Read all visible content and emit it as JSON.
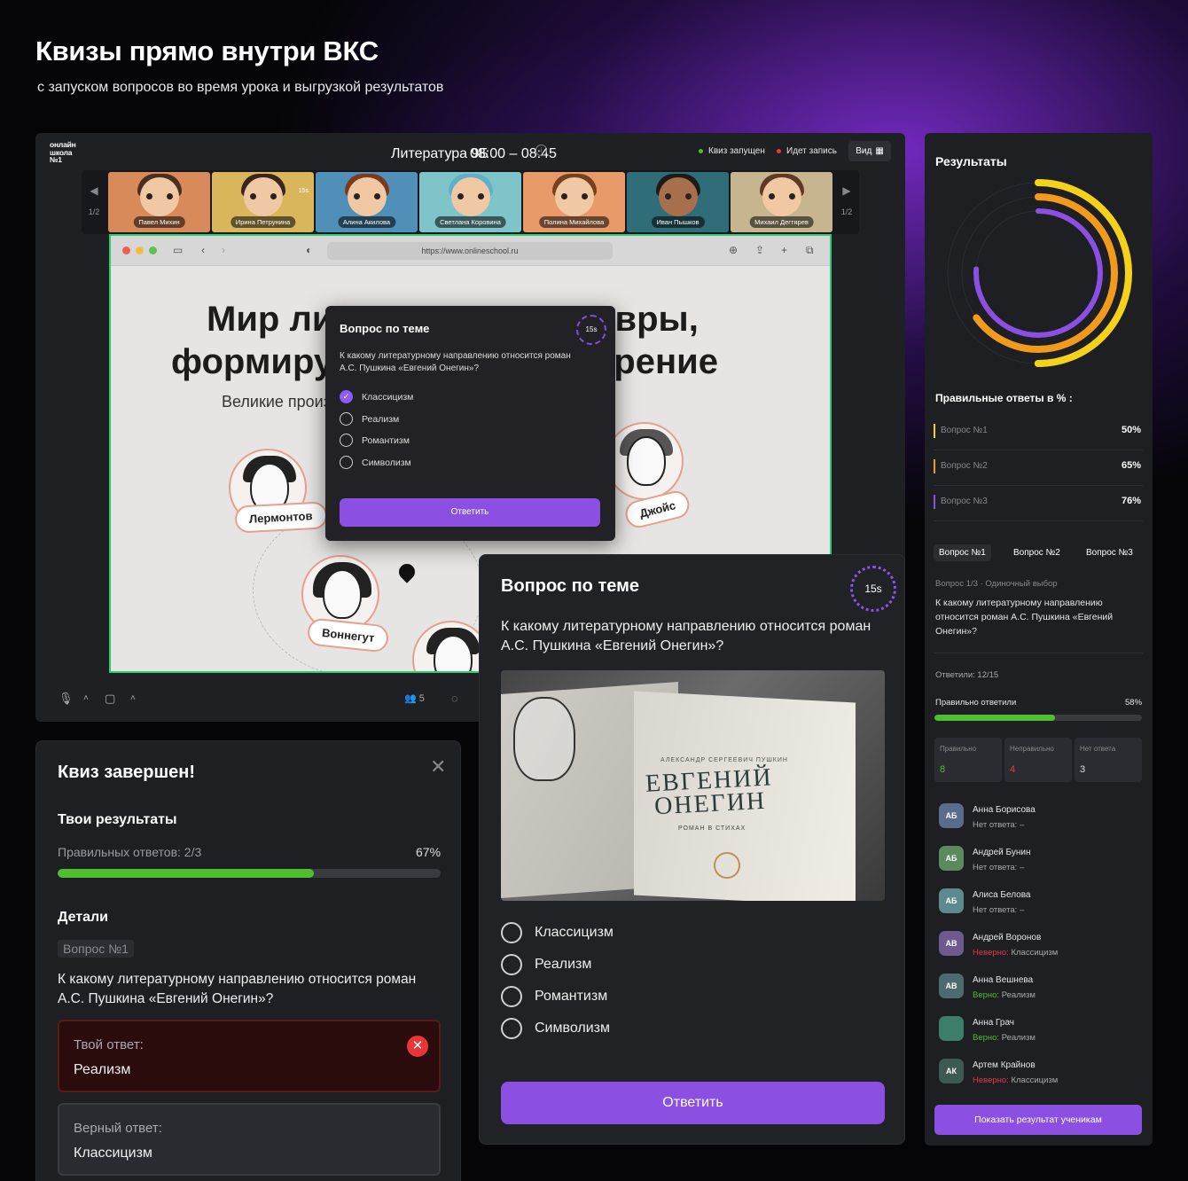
{
  "header": {
    "title": "Квизы прямо внутри ВКС",
    "subtitle": "с запуском вопросов во время урока и выгрузкой результатов"
  },
  "vks": {
    "logo": "онлайн школа №1",
    "lesson": "Литература 9Б",
    "time": "08:00 – 08:45",
    "status_quiz": "Квиз запущен",
    "status_rec": "Идет запись",
    "view_label": "Вид",
    "page_left": "1/2",
    "page_right": "1/2",
    "participants": [
      "Павел Михин",
      "Ирина Петрунина",
      "Алина Акилова",
      "Светлана Коровина",
      "Полина Михайлова",
      "Иван Пышков",
      "Михаил Дегтярев"
    ],
    "tile_timer": "15s",
    "url": "https://www.onlineschool.ru",
    "slide_line1": "Мир литературы: шедевры,",
    "slide_line2": "формирующие мировоззрение",
    "slide_sub": "Великие произведения, личность и общество",
    "authors": [
      "Лермонтов",
      "Джойс",
      "Воннегут"
    ],
    "participants_count": "5"
  },
  "quiz_popup": {
    "title": "Вопрос по теме",
    "timer": "15s",
    "question": "К какому литературному направлению относится роман А.С. Пушкина «Евгений Онегин»?",
    "options": [
      "Классицизм",
      "Реализм",
      "Романтизм",
      "Символизм"
    ],
    "selected_index": 0,
    "submit": "Ответить"
  },
  "finished": {
    "title": "Квиз завершен!",
    "results_title": "Твои результаты",
    "correct_label": "Правильных ответов: 2/3",
    "correct_pct": "67%",
    "correct_fraction": 0.67,
    "details_title": "Детали",
    "question_chip": "Вопрос №1",
    "question": "К какому литературному направлению относится роман А.С. Пушкина «Евгений Онегин»?",
    "your_answer_label": "Твой ответ:",
    "your_answer": "Реализм",
    "correct_answer_label": "Верный ответ:",
    "correct_answer": "Классицизм"
  },
  "quiz_big": {
    "title": "Вопрос по теме",
    "timer": "15s",
    "question": "К какому литературному направлению относится роман А.С. Пушкина «Евгений Онегин»?",
    "book_author": "АЛЕКСАНДР СЕРГЕЕВИЧ ПУШКИН",
    "book_title": "ЕВГЕНИЙ ОНЕГИН",
    "book_sub": "РОМАН В СТИХАХ",
    "options": [
      "Классицизм",
      "Реализм",
      "Романтизм",
      "Символизм"
    ],
    "submit": "Ответить"
  },
  "results": {
    "title": "Результаты",
    "pct_title": "Правильные ответы в % :",
    "rows": [
      {
        "label": "Вопрос №1",
        "value": "50%",
        "fraction": 0.5,
        "color": "#f5d21a"
      },
      {
        "label": "Вопрос №2",
        "value": "65%",
        "fraction": 0.65,
        "color": "#f29a1b"
      },
      {
        "label": "Вопрос №3",
        "value": "76%",
        "fraction": 0.76,
        "color": "#8b4fe2"
      }
    ],
    "tabs": [
      "Вопрос №1",
      "Вопрос №2",
      "Вопрос №3"
    ],
    "meta": "Вопрос 1/3  ·  Одиночный выбор",
    "question": "К какому литературному направлению относится роман А.С. Пушкина «Евгений Онегин»?",
    "answered": "Ответили: 12/15",
    "correct_label": "Правильно ответили",
    "correct_pct": "58%",
    "correct_fraction": 0.58,
    "stats": [
      {
        "label": "Правильно",
        "value": "8",
        "color": "#4fbf2f"
      },
      {
        "label": "Неправильно",
        "value": "4",
        "color": "#e23b3b"
      },
      {
        "label": "Нет ответа",
        "value": "3",
        "color": "#dddddd"
      }
    ],
    "students": [
      {
        "initials": "АБ",
        "name": "Анна Борисова",
        "status": "Нет ответа:",
        "answer": "–",
        "status_color": "#aaaaaa",
        "avatar_color": "#5b6b8e"
      },
      {
        "initials": "АБ",
        "name": "Андрей Бунин",
        "status": "Нет ответа:",
        "answer": "–",
        "status_color": "#aaaaaa",
        "avatar_color": "#5a8a5e"
      },
      {
        "initials": "АБ",
        "name": "Алиса Белова",
        "status": "Нет ответа:",
        "answer": "–",
        "status_color": "#aaaaaa",
        "avatar_color": "#5c8a8e"
      },
      {
        "initials": "АВ",
        "name": "Андрей Воронов",
        "status": "Неверно:",
        "answer": "Классицизм",
        "status_color": "#e23b3b",
        "avatar_color": "#6e5a8e"
      },
      {
        "initials": "АВ",
        "name": "Анна Вешнева",
        "status": "Верно:",
        "answer": "Реализм",
        "status_color": "#4fbf2f",
        "avatar_color": "#4d6b6e"
      },
      {
        "initials": "",
        "name": "Анна Грач",
        "status": "Верно:",
        "answer": "Реализм",
        "status_color": "#4fbf2f",
        "avatar_color": "#3c7d6b"
      },
      {
        "initials": "АК",
        "name": "Артем Крайнов",
        "status": "Неверно:",
        "answer": "Классицизм",
        "status_color": "#e23b3b",
        "avatar_color": "#3d5a52"
      }
    ],
    "show_button": "Показать результат ученикам"
  }
}
